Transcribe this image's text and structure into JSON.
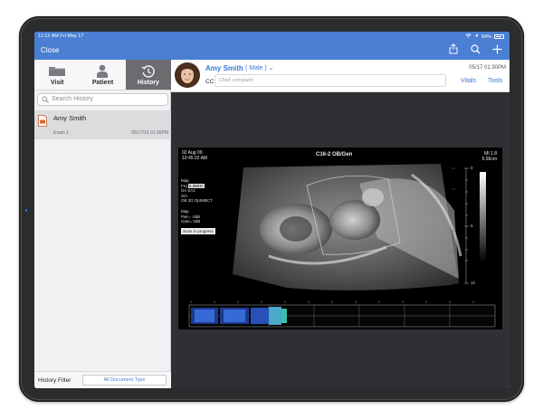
{
  "status_bar": {
    "time": "11:12 AM",
    "date": "Fri May 17",
    "battery": "84%"
  },
  "nav": {
    "close_label": "Close",
    "icons": [
      "share-icon",
      "search-icon",
      "plus-icon"
    ]
  },
  "tabs": [
    {
      "label": "Visit",
      "icon": "folder-icon",
      "active": false
    },
    {
      "label": "Patient",
      "icon": "person-icon",
      "active": false
    },
    {
      "label": "History",
      "icon": "history-icon",
      "active": true
    }
  ],
  "search": {
    "placeholder": "Search History"
  },
  "history_items": [
    {
      "name": "Amy Smith",
      "exam": "Exam 1",
      "date": "05/17/19 01:30PM"
    }
  ],
  "filter": {
    "label": "History Filter",
    "button_label": "All Document Type"
  },
  "patient": {
    "name": "Amy Smith",
    "gender": "( Male )",
    "date": "05/17 01:30PM",
    "cc_label": "CC",
    "cc_placeholder": "Chief complaint",
    "vitals_label": "Vitals",
    "tools_label": "Tools"
  },
  "ultrasound": {
    "date": "02 Aug 09",
    "time": "10:45:32 AM",
    "title": "C16-2 OB/Gen",
    "mi": "MI 1.8",
    "depth": "5.56cm",
    "params": [
      "Map",
      "Frq",
      "Gn",
      "S/A",
      "OB"
    ],
    "params_values": [
      "",
      "5.0MHz",
      "SA1",
      "",
      "2D OptMBCT"
    ],
    "params2": [
      "Map",
      "Pwr=",
      "Gain="
    ],
    "params2_values": [
      "",
      "-3dB",
      "0dB"
    ],
    "scan_label": "Scan in progress",
    "depth_ticks": [
      "0",
      "5",
      "10"
    ]
  }
}
